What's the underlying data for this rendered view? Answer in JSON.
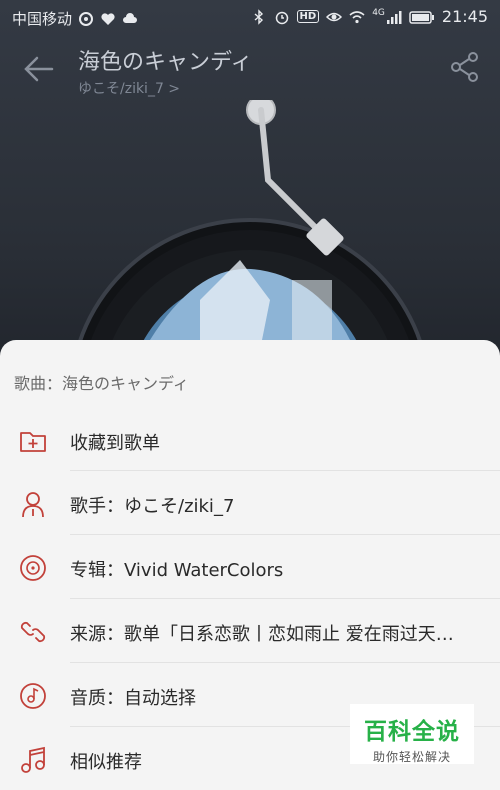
{
  "status_bar": {
    "carrier": "中国移动",
    "time": "21:45",
    "network": "4G",
    "hd_badge": "HD",
    "icons_left": [
      "swirl-icon",
      "heart-pulse-icon",
      "cloud-icon"
    ],
    "icons_right": [
      "bluetooth-icon",
      "alarm-icon",
      "hd-icon",
      "eye-icon",
      "wifi-icon",
      "signal-icon",
      "battery-icon"
    ]
  },
  "player": {
    "song_title": "海色のキャンディ",
    "artist_line": "ゆこそ/ziki_7 >",
    "icons": [
      "back-arrow-icon",
      "share-icon"
    ]
  },
  "sheet": {
    "title": "歌曲：海色のキャンディ",
    "items": [
      {
        "label": "收藏到歌单",
        "icon": "folder-add-icon"
      },
      {
        "label": "歌手：ゆこそ/ziki_7",
        "icon": "singer-icon"
      },
      {
        "label": "专辑：Vivid WaterColors",
        "icon": "album-disc-icon"
      },
      {
        "label": "来源：歌单「日系恋歌丨恋如雨止 爱在雨过天…",
        "icon": "link-icon"
      },
      {
        "label": "音质：自动选择",
        "icon": "quality-icon"
      },
      {
        "label": "相似推荐",
        "icon": "music-note-icon"
      }
    ]
  },
  "watermark": {
    "main": "百科全说",
    "sub": "助你轻松解决"
  },
  "colors": {
    "accent": "#c2413a",
    "sheet_bg": "#f4f4f4",
    "watermark_green": "#27b148"
  }
}
